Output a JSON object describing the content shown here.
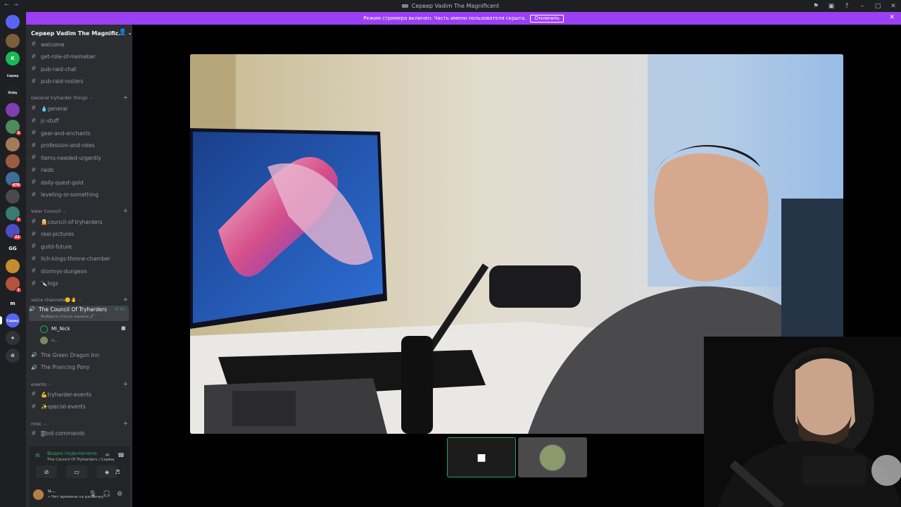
{
  "titlebar": {
    "title": "Сервер Vadim The Magnificent",
    "nav": "← →"
  },
  "banner": {
    "text": "Режим стримера включен. Часть имени пользователя скрыта.",
    "button": "Отключить",
    "close": "✕"
  },
  "rail": {
    "items": [
      {
        "label": "",
        "color": "#5865f2"
      },
      {
        "label": "",
        "color": "#7a5f3b"
      },
      {
        "label": "K",
        "color": "#19b955"
      },
      {
        "label": "Сервер",
        "color": "#1e1f22"
      },
      {
        "label": "Staby",
        "color": "#202225"
      },
      {
        "label": "",
        "color": "#7d3fb0"
      },
      {
        "label": "",
        "color": "#4b8c5d",
        "badge": "3"
      },
      {
        "label": "",
        "color": "#a37b58"
      },
      {
        "label": "",
        "color": "#9a5b43"
      },
      {
        "label": "",
        "color": "#3e6d9a",
        "badge": "476"
      },
      {
        "label": "",
        "color": "#4a4a4a"
      },
      {
        "label": "",
        "color": "#3a7a72",
        "badge": "1"
      },
      {
        "label": "",
        "color": "#4b4fbf",
        "badge": "22"
      },
      {
        "label": "GG",
        "color": "#1e1f22"
      },
      {
        "label": "",
        "color": "#c68b2e"
      },
      {
        "label": "",
        "color": "#b5533f",
        "badge": "1"
      },
      {
        "label": "m",
        "color": "#1e1f22"
      },
      {
        "label": "Сервер",
        "color": "#5865f2"
      },
      {
        "label": "+",
        "color": "#313338"
      },
      {
        "label": "⊘",
        "color": "#313338"
      }
    ]
  },
  "sidebar": {
    "server_name": "Сервер Vadim The Magnific...",
    "channels_top": [
      "welcome",
      "get-role-of-memeber",
      "pub-raid-chat",
      "pub-raid-rosters"
    ],
    "cat1": "General tryharder things",
    "cat1_channels": [
      "💧general",
      "jc-stuff",
      "gear-and-enchants",
      "profession-and-roles",
      "items-needed-urgently",
      "raids",
      "daily-quest-gold",
      "leveling-or-something"
    ],
    "cat2": "Valar Council",
    "cat2_channels": [
      "🧝council-of-tryharders",
      "real-pictures",
      "guild-future",
      "lich-kings-throne-chamber",
      "stormys-dungeon",
      "🔪logs"
    ],
    "cat3": "voice channels🤫🤚",
    "voice_active": "The Council Of Tryharders",
    "voice_time": "9:39",
    "voice_status": "Выбрать статус канала 🖉",
    "voice_user1": "Mi_Nick",
    "voice_user2": "u...",
    "voice_other": [
      "The Green Dragon Inn",
      "The Prancing Pony"
    ],
    "cat4": "events",
    "cat4_channels": [
      "💪tryharder-events",
      "✨special-events"
    ],
    "cat5": "misc",
    "cat5_channels": [
      "🀫bot-commands"
    ]
  },
  "voice_panel": {
    "status": "Видео подключено",
    "sub": "The Council Of Tryharders / Сервер Vad...",
    "user": "u...",
    "user_status": "• Нет времени на раскачку"
  }
}
